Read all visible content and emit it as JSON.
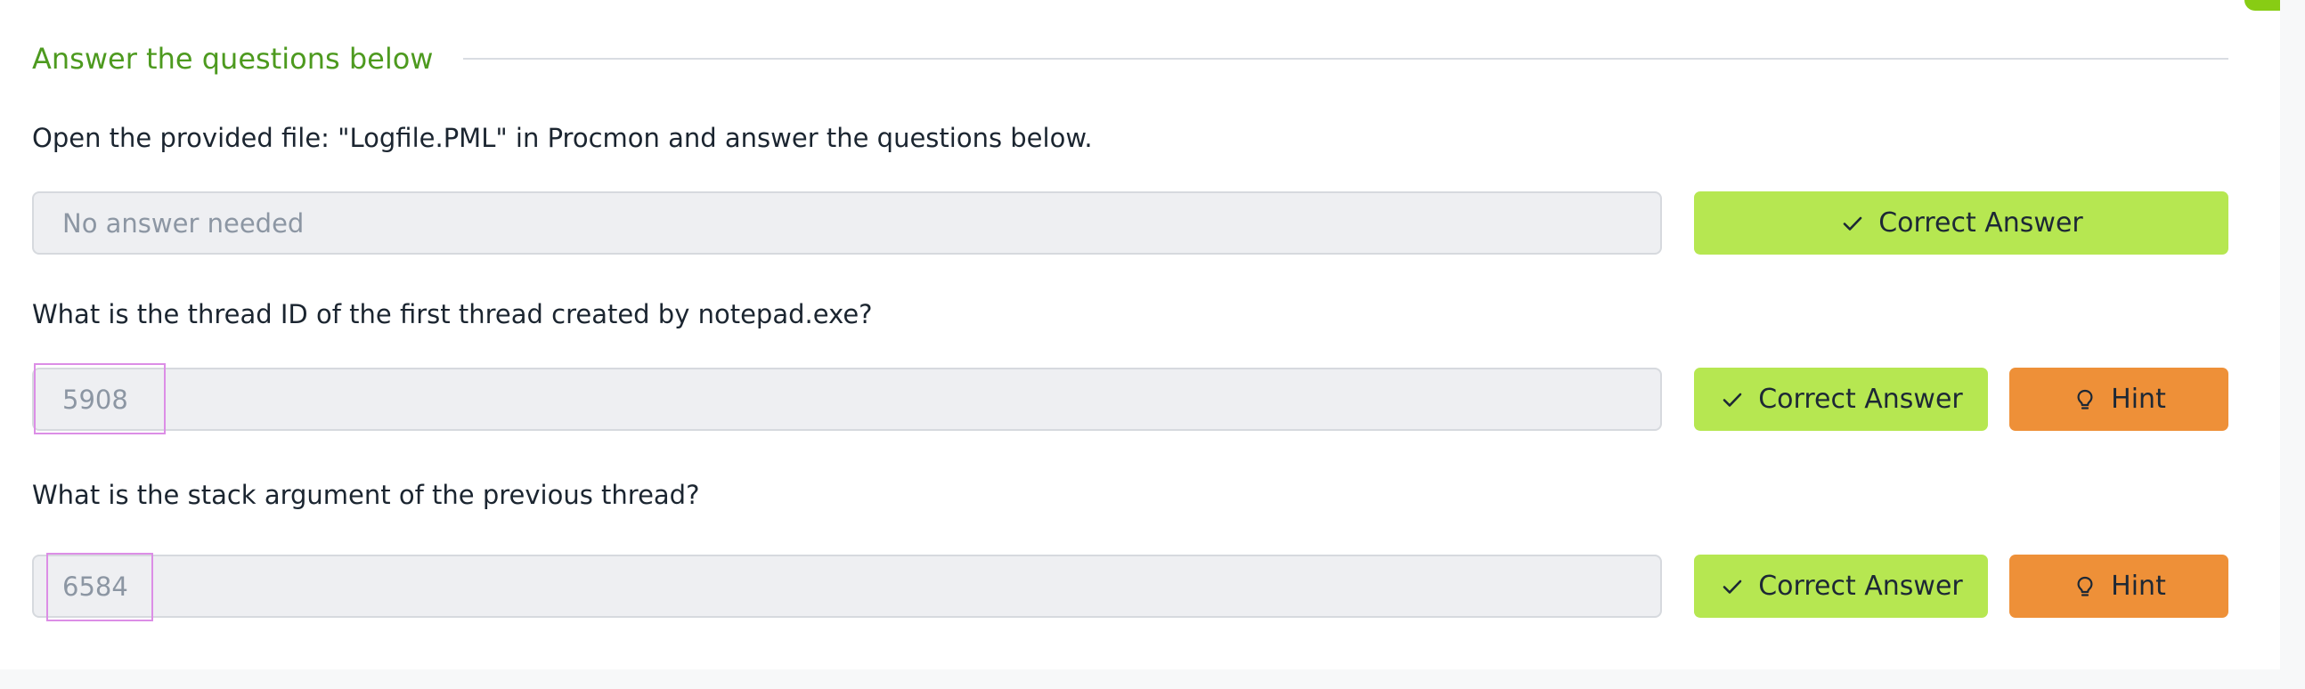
{
  "section": {
    "title": "Answer the questions below"
  },
  "questions": [
    {
      "text": "Open the provided file: \"Logfile.PML\" in Procmon and answer the questions below.",
      "answer_value": "No answer needed",
      "correct_label": "Correct Answer"
    },
    {
      "text": "What is the thread ID of the first thread created by notepad.exe?",
      "answer_value": "5908",
      "correct_label": "Correct Answer",
      "hint_label": "Hint"
    },
    {
      "text": "What is the stack argument of the previous thread?",
      "answer_value": "6584",
      "correct_label": "Correct Answer",
      "hint_label": "Hint"
    }
  ],
  "colors": {
    "accent_green": "#88cc14",
    "correct_button": "#b6e751",
    "hint_button": "#ee9038",
    "section_title": "#4d9a1f"
  },
  "icons": {
    "correct": "checkmark-icon",
    "hint": "lightbulb-icon"
  }
}
